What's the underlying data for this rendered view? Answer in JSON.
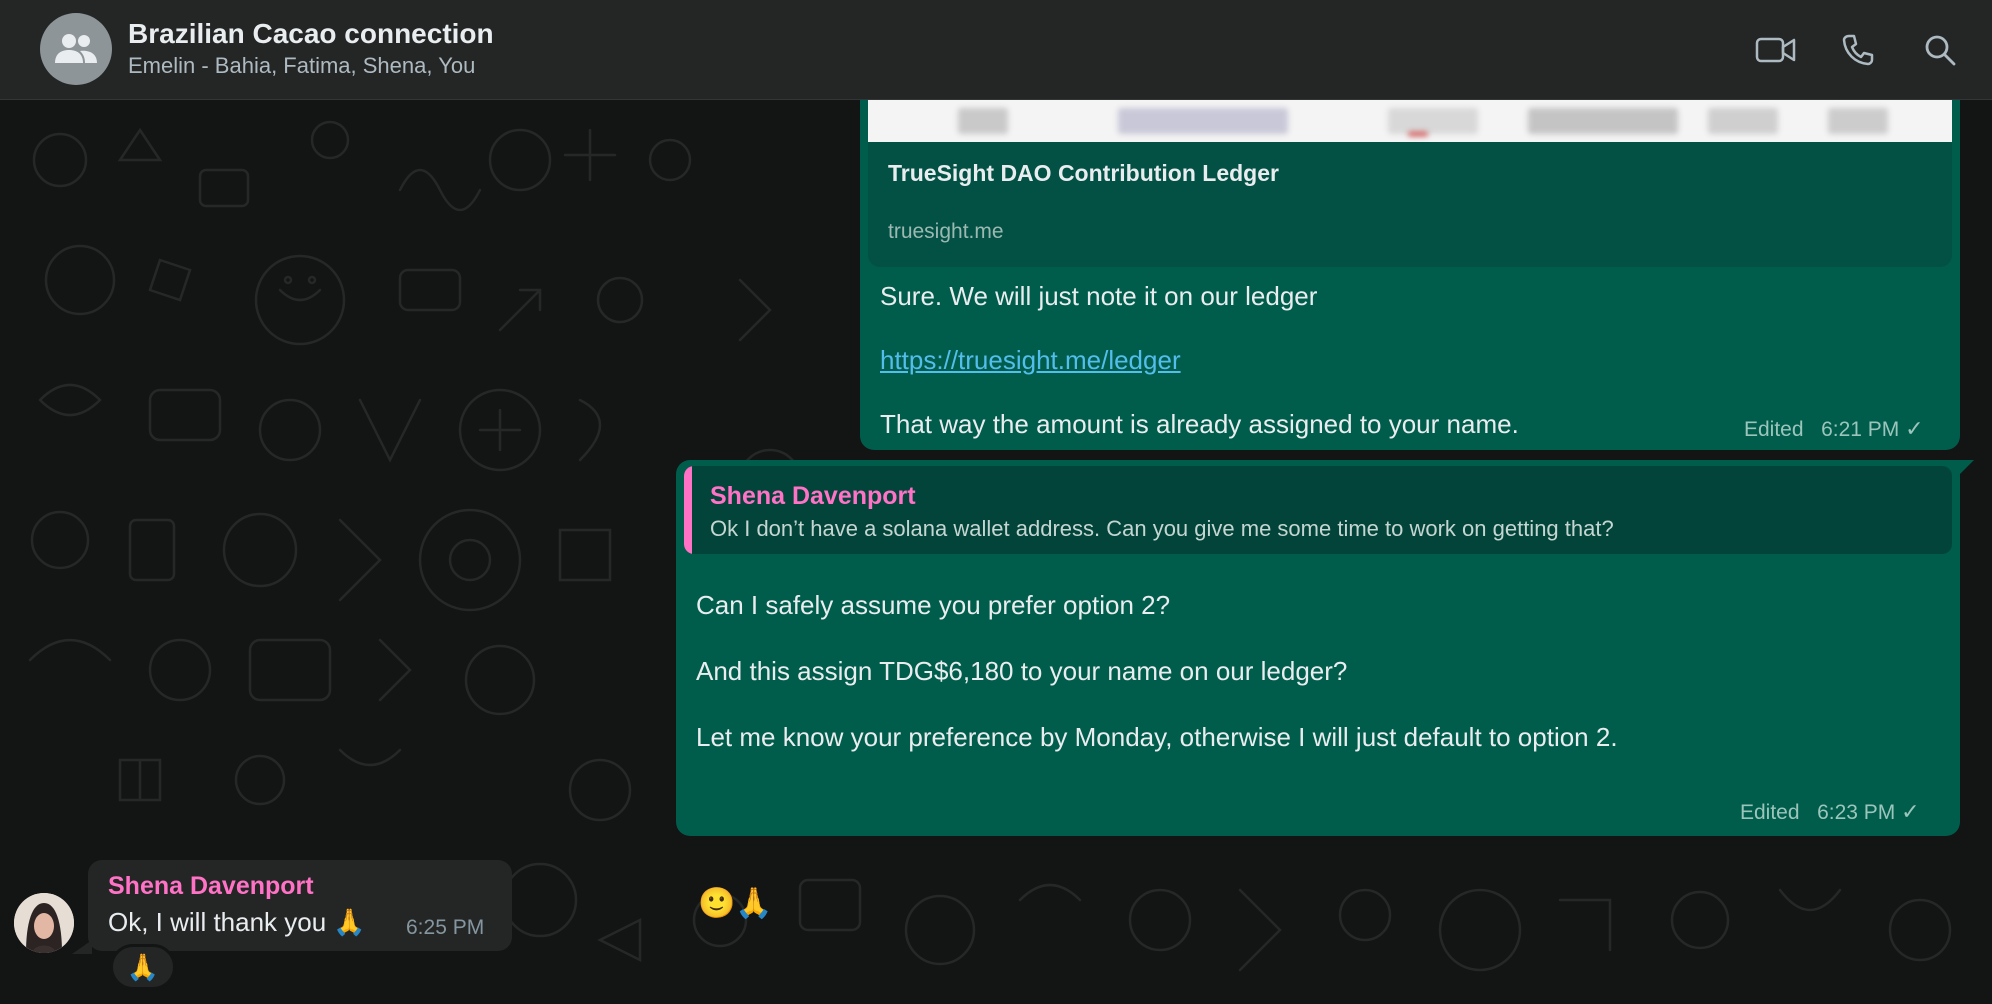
{
  "header": {
    "title": "Brazilian Cacao connection",
    "members": "Emelin - Bahia, Fatima, Shena, You",
    "icons": [
      "group-avatar-icon",
      "video-call-icon",
      "voice-call-icon",
      "search-icon"
    ]
  },
  "messages": {
    "first": {
      "preview_title": "TrueSight DAO Contribution Ledger",
      "preview_domain": "truesight.me",
      "line1": "Sure. We will just note it on our ledger",
      "link": "https://truesight.me/ledger",
      "line3": "That way the amount is already assigned to your name.",
      "edited": "Edited",
      "time": "6:21 PM",
      "tick": "✓"
    },
    "second": {
      "quote_author": "Shena Davenport",
      "quote_text": "Ok I don’t have a solana wallet address. Can you give me some time to work on getting that?",
      "line1": "Can I safely assume you prefer option 2?",
      "line2": "And this assign TDG$6,180 to your name on our ledger?",
      "line3": "Let me know your preference by Monday, otherwise I will just default to option 2.",
      "emojis": "🙂🙏",
      "edited": "Edited",
      "time": "6:23 PM",
      "tick": "✓"
    },
    "incoming": {
      "author": "Shena Davenport",
      "text": "Ok, I will thank you 🙏",
      "time": "6:25 PM",
      "reaction": "🙏"
    }
  },
  "colors": {
    "outgoing_bubble": "#005c4b",
    "incoming_bubble": "#242626",
    "author_name": "#ff72c6",
    "link": "#53bdeb",
    "background": "#131414"
  }
}
